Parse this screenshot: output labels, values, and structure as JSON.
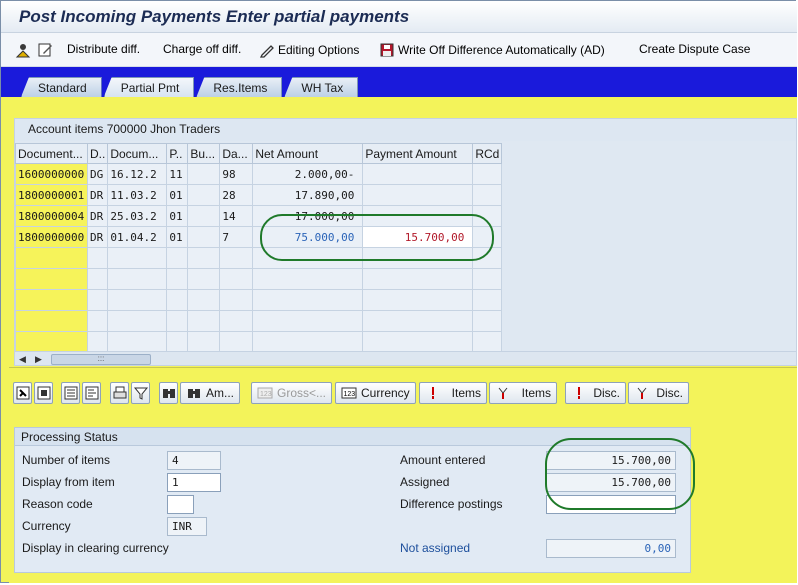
{
  "window": {
    "title": "Post Incoming Payments Enter partial payments"
  },
  "appbar": {
    "distribute_label": "Distribute diff.",
    "chargeoff_label": "Charge off diff.",
    "editing_label": "Editing Options",
    "writeoff_label": "Write Off Difference Automatically (AD)",
    "dispute_label": "Create Dispute Case"
  },
  "tabs": [
    {
      "label": "Standard"
    },
    {
      "label": "Partial Pmt",
      "active": true
    },
    {
      "label": "Res.Items"
    },
    {
      "label": "WH Tax"
    }
  ],
  "account_items": {
    "header": "Account items 700000 Jhon Traders",
    "columns": [
      "Document...",
      "D..",
      "Docum...",
      "P..",
      "Bu...",
      "Da...",
      "Net Amount",
      "Payment Amount",
      "RCd"
    ],
    "rows": [
      [
        "1600000000",
        "DG",
        "16.12.2",
        "11",
        "",
        "98",
        "2.000,00-",
        "",
        ""
      ],
      [
        "1800000001",
        "DR",
        "11.03.2",
        "01",
        "",
        "28",
        "17.890,00",
        "",
        ""
      ],
      [
        "1800000004",
        "DR",
        "25.03.2",
        "01",
        "",
        "14",
        "17.000,00",
        "",
        ""
      ],
      [
        "1800000000",
        "DR",
        "01.04.2",
        "01",
        "",
        "7",
        "75.000,00",
        "15.700,00",
        ""
      ]
    ],
    "scroll_thumb": ":::"
  },
  "toolbar2": {
    "am_label": "Am...",
    "gross_label": "Gross<...",
    "currency_label": "Currency",
    "items1_label": "Items",
    "items2_label": "Items",
    "disc1_label": "Disc.",
    "disc2_label": "Disc."
  },
  "processing_status": {
    "header": "Processing Status",
    "number_of_items_label": "Number of items",
    "number_of_items": "4",
    "display_from_item_label": "Display from item",
    "display_from_item": "1",
    "reason_code_label": "Reason code",
    "reason_code": "",
    "currency_label": "Currency",
    "currency": "INR",
    "display_clearing_label": "Display in clearing currency",
    "amount_entered_label": "Amount entered",
    "amount_entered": "15.700,00",
    "assigned_label": "Assigned",
    "assigned": "15.700,00",
    "difference_postings_label": "Difference postings",
    "difference_postings": "",
    "not_assigned_label": "Not assigned",
    "not_assigned": "0,00"
  },
  "colors": {
    "background_yellow": "#f3f35a",
    "accent_blue": "#1a1adb",
    "highlight_green": "#1f7a2a",
    "payment_red": "#b21a2a"
  },
  "icons": [
    "person-icon",
    "edit-icon",
    "pencil-icon",
    "save-icon",
    "select-all-icon",
    "deselect-icon",
    "detail-icon",
    "list-icon",
    "print-icon",
    "filter-icon",
    "find-icon",
    "find-next-icon",
    "currency-icon",
    "items-icon",
    "disc-icon"
  ]
}
